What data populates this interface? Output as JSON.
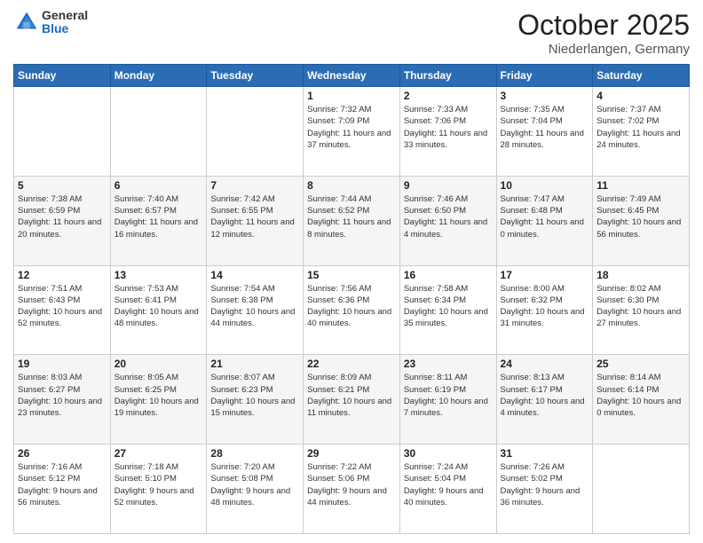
{
  "header": {
    "logo_general": "General",
    "logo_blue": "Blue",
    "title": "October 2025",
    "subtitle": "Niederlangen, Germany"
  },
  "days_of_week": [
    "Sunday",
    "Monday",
    "Tuesday",
    "Wednesday",
    "Thursday",
    "Friday",
    "Saturday"
  ],
  "weeks": [
    [
      {
        "day": "",
        "info": ""
      },
      {
        "day": "",
        "info": ""
      },
      {
        "day": "",
        "info": ""
      },
      {
        "day": "1",
        "info": "Sunrise: 7:32 AM\nSunset: 7:09 PM\nDaylight: 11 hours and 37 minutes."
      },
      {
        "day": "2",
        "info": "Sunrise: 7:33 AM\nSunset: 7:06 PM\nDaylight: 11 hours and 33 minutes."
      },
      {
        "day": "3",
        "info": "Sunrise: 7:35 AM\nSunset: 7:04 PM\nDaylight: 11 hours and 28 minutes."
      },
      {
        "day": "4",
        "info": "Sunrise: 7:37 AM\nSunset: 7:02 PM\nDaylight: 11 hours and 24 minutes."
      }
    ],
    [
      {
        "day": "5",
        "info": "Sunrise: 7:38 AM\nSunset: 6:59 PM\nDaylight: 11 hours and 20 minutes."
      },
      {
        "day": "6",
        "info": "Sunrise: 7:40 AM\nSunset: 6:57 PM\nDaylight: 11 hours and 16 minutes."
      },
      {
        "day": "7",
        "info": "Sunrise: 7:42 AM\nSunset: 6:55 PM\nDaylight: 11 hours and 12 minutes."
      },
      {
        "day": "8",
        "info": "Sunrise: 7:44 AM\nSunset: 6:52 PM\nDaylight: 11 hours and 8 minutes."
      },
      {
        "day": "9",
        "info": "Sunrise: 7:46 AM\nSunset: 6:50 PM\nDaylight: 11 hours and 4 minutes."
      },
      {
        "day": "10",
        "info": "Sunrise: 7:47 AM\nSunset: 6:48 PM\nDaylight: 11 hours and 0 minutes."
      },
      {
        "day": "11",
        "info": "Sunrise: 7:49 AM\nSunset: 6:45 PM\nDaylight: 10 hours and 56 minutes."
      }
    ],
    [
      {
        "day": "12",
        "info": "Sunrise: 7:51 AM\nSunset: 6:43 PM\nDaylight: 10 hours and 52 minutes."
      },
      {
        "day": "13",
        "info": "Sunrise: 7:53 AM\nSunset: 6:41 PM\nDaylight: 10 hours and 48 minutes."
      },
      {
        "day": "14",
        "info": "Sunrise: 7:54 AM\nSunset: 6:38 PM\nDaylight: 10 hours and 44 minutes."
      },
      {
        "day": "15",
        "info": "Sunrise: 7:56 AM\nSunset: 6:36 PM\nDaylight: 10 hours and 40 minutes."
      },
      {
        "day": "16",
        "info": "Sunrise: 7:58 AM\nSunset: 6:34 PM\nDaylight: 10 hours and 35 minutes."
      },
      {
        "day": "17",
        "info": "Sunrise: 8:00 AM\nSunset: 6:32 PM\nDaylight: 10 hours and 31 minutes."
      },
      {
        "day": "18",
        "info": "Sunrise: 8:02 AM\nSunset: 6:30 PM\nDaylight: 10 hours and 27 minutes."
      }
    ],
    [
      {
        "day": "19",
        "info": "Sunrise: 8:03 AM\nSunset: 6:27 PM\nDaylight: 10 hours and 23 minutes."
      },
      {
        "day": "20",
        "info": "Sunrise: 8:05 AM\nSunset: 6:25 PM\nDaylight: 10 hours and 19 minutes."
      },
      {
        "day": "21",
        "info": "Sunrise: 8:07 AM\nSunset: 6:23 PM\nDaylight: 10 hours and 15 minutes."
      },
      {
        "day": "22",
        "info": "Sunrise: 8:09 AM\nSunset: 6:21 PM\nDaylight: 10 hours and 11 minutes."
      },
      {
        "day": "23",
        "info": "Sunrise: 8:11 AM\nSunset: 6:19 PM\nDaylight: 10 hours and 7 minutes."
      },
      {
        "day": "24",
        "info": "Sunrise: 8:13 AM\nSunset: 6:17 PM\nDaylight: 10 hours and 4 minutes."
      },
      {
        "day": "25",
        "info": "Sunrise: 8:14 AM\nSunset: 6:14 PM\nDaylight: 10 hours and 0 minutes."
      }
    ],
    [
      {
        "day": "26",
        "info": "Sunrise: 7:16 AM\nSunset: 5:12 PM\nDaylight: 9 hours and 56 minutes."
      },
      {
        "day": "27",
        "info": "Sunrise: 7:18 AM\nSunset: 5:10 PM\nDaylight: 9 hours and 52 minutes."
      },
      {
        "day": "28",
        "info": "Sunrise: 7:20 AM\nSunset: 5:08 PM\nDaylight: 9 hours and 48 minutes."
      },
      {
        "day": "29",
        "info": "Sunrise: 7:22 AM\nSunset: 5:06 PM\nDaylight: 9 hours and 44 minutes."
      },
      {
        "day": "30",
        "info": "Sunrise: 7:24 AM\nSunset: 5:04 PM\nDaylight: 9 hours and 40 minutes."
      },
      {
        "day": "31",
        "info": "Sunrise: 7:26 AM\nSunset: 5:02 PM\nDaylight: 9 hours and 36 minutes."
      },
      {
        "day": "",
        "info": ""
      }
    ]
  ]
}
